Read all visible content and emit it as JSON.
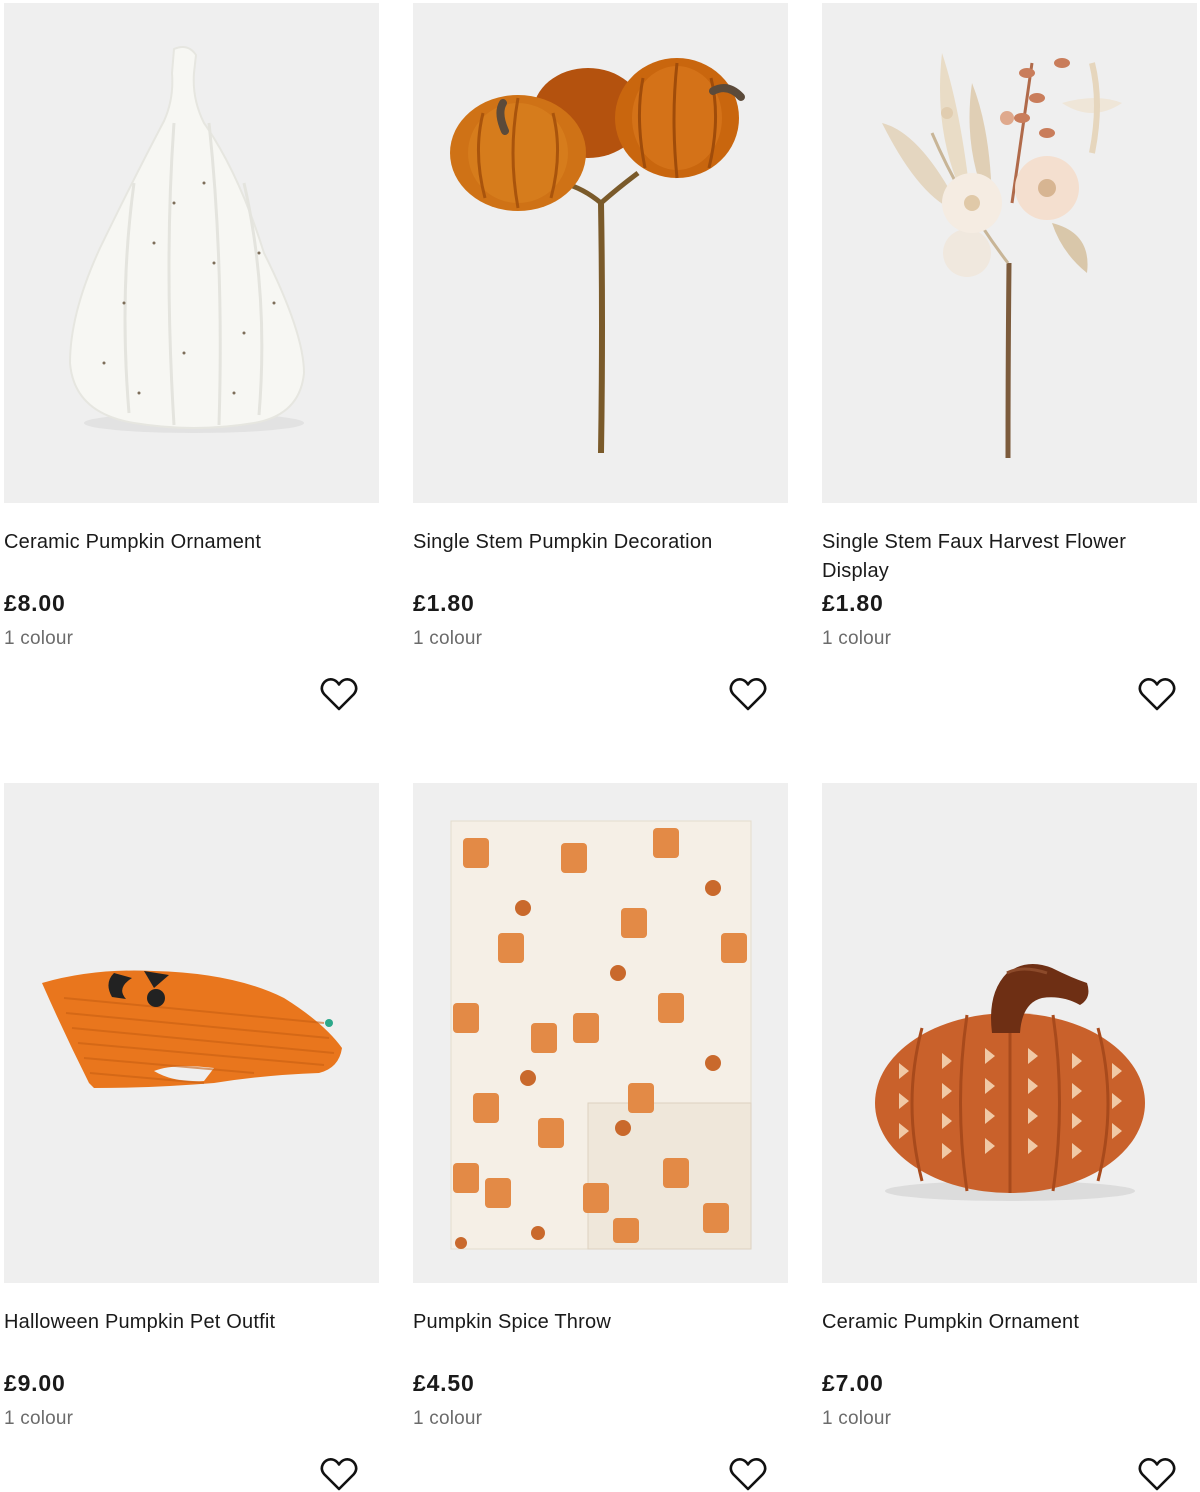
{
  "products": [
    {
      "name": "Ceramic Pumpkin Ornament",
      "price": "£8.00",
      "colours": "1 colour",
      "image_icon": "white-ceramic-pumpkin-image"
    },
    {
      "name": "Single Stem Pumpkin Decoration",
      "price": "£1.80",
      "colours": "1 colour",
      "image_icon": "velvet-pumpkin-stem-image"
    },
    {
      "name": "Single Stem Faux Harvest Flower Display",
      "price": "£1.80",
      "colours": "1 colour",
      "image_icon": "faux-flower-stem-image"
    },
    {
      "name": "Halloween Pumpkin Pet Outfit",
      "price": "£9.00",
      "colours": "1 colour",
      "image_icon": "pet-outfit-image"
    },
    {
      "name": "Pumpkin Spice Throw",
      "price": "£4.50",
      "colours": "1 colour",
      "image_icon": "pumpkin-spice-throw-image"
    },
    {
      "name": "Ceramic Pumpkin Ornament",
      "price": "£7.00",
      "colours": "1 colour",
      "image_icon": "orange-ceramic-pumpkin-image"
    }
  ],
  "colors": {
    "image_bg": "#efefef",
    "text": "#1a1a1a",
    "muted": "#6b6b6b"
  }
}
